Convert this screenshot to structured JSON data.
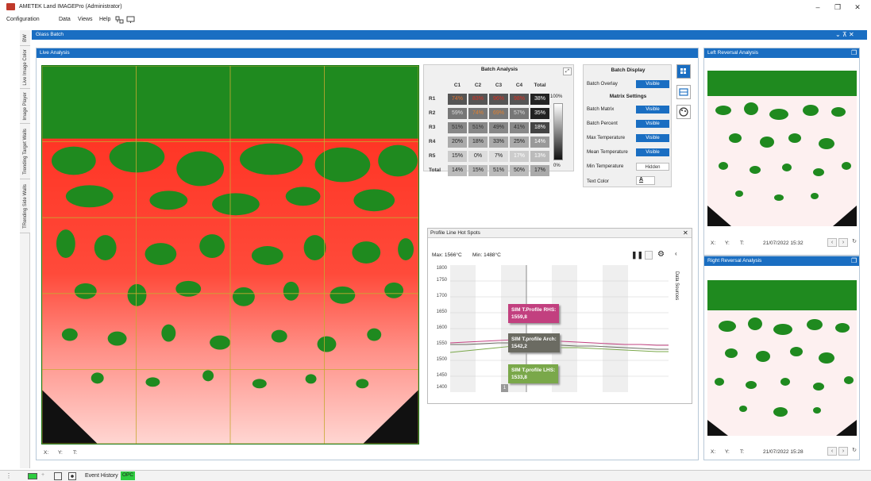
{
  "window": {
    "title": "AMETEK Land IMAGEPro (Administrator)",
    "minimize": "–",
    "maximize": "❐",
    "close": "✕"
  },
  "menu": [
    "Configuration",
    "Data",
    "Views",
    "Help"
  ],
  "side_tabs": [
    "BW",
    "Live Image Color",
    "Image Player",
    "Trending Target Walls",
    "TRending Side Walls"
  ],
  "glass_batch": {
    "title": "Glass Batch",
    "controls": "⌄ ⊼ ✕"
  },
  "live_analysis": {
    "title": "Live Analysis",
    "coords": {
      "x": "X:",
      "y": "Y:",
      "t": "T:"
    }
  },
  "batch_analysis": {
    "title": "Batch Analysis",
    "columns": [
      "C1",
      "C2",
      "C3",
      "C4",
      "Total"
    ],
    "rows": [
      {
        "label": "R1",
        "cells": [
          "74%",
          "83%",
          "96%",
          "98%",
          "38%"
        ]
      },
      {
        "label": "R2",
        "cells": [
          "59%",
          "74%",
          "69%",
          "57%",
          "35%"
        ]
      },
      {
        "label": "R3",
        "cells": [
          "51%",
          "51%",
          "49%",
          "41%",
          "18%"
        ]
      },
      {
        "label": "R4",
        "cells": [
          "20%",
          "18%",
          "33%",
          "25%",
          "14%"
        ]
      },
      {
        "label": "R5",
        "cells": [
          "15%",
          "0%",
          "7%",
          "17%",
          "13%"
        ]
      },
      {
        "label": "Total",
        "cells": [
          "14%",
          "15%",
          "51%",
          "50%",
          "17%"
        ]
      }
    ],
    "scale_max": "100%",
    "scale_min": "0%"
  },
  "batch_display": {
    "title": "Batch Display",
    "overlay_label": "Batch Overlay",
    "overlay_value": "Visible",
    "matrix_title": "Matrix Settings",
    "settings": [
      {
        "label": "Batch Matrix",
        "value": "Visible"
      },
      {
        "label": "Batch Percent",
        "value": "Visible"
      },
      {
        "label": "Max Temperature",
        "value": "Visible"
      },
      {
        "label": "Mean Temperature",
        "value": "Visible"
      },
      {
        "label": "Min Temperature",
        "value": "Hidden"
      }
    ],
    "text_color_label": "Text Color",
    "text_color_value": "A"
  },
  "profile": {
    "title": "Profile Line Hot Spots",
    "max": "Max: 1566°C",
    "min": "Min: 1488°C",
    "side_label": "Data Sources",
    "yticks": [
      "1800",
      "1750",
      "1700",
      "1650",
      "1600",
      "1550",
      "1500",
      "1450",
      "1400"
    ],
    "tooltips": [
      {
        "name": "SIM T.Profile RHS:",
        "value": "1559,8"
      },
      {
        "name": "SIM T.profile Arch:",
        "value": "1542,2"
      },
      {
        "name": "SIM T.profile LHS:",
        "value": "1533,8"
      }
    ],
    "marker": "1"
  },
  "left_reversal": {
    "title": "Left Reversal Analysis",
    "x": "X:",
    "y": "Y:",
    "t": "T:",
    "timestamp": "21/07/2022 15:32"
  },
  "right_reversal": {
    "title": "Right Reversal Analysis",
    "x": "X:",
    "y": "Y:",
    "t": "T:",
    "timestamp": "21/07/2022 15:28"
  },
  "status": {
    "event_history": "Event History",
    "opc": "OPC"
  },
  "colors": {
    "accent": "#1a6ec2",
    "hot_red": "#e8322a",
    "green": "#1f8a1f",
    "rhs": "#c2407f",
    "arch": "#6b6b62",
    "lhs": "#7aa84a"
  }
}
